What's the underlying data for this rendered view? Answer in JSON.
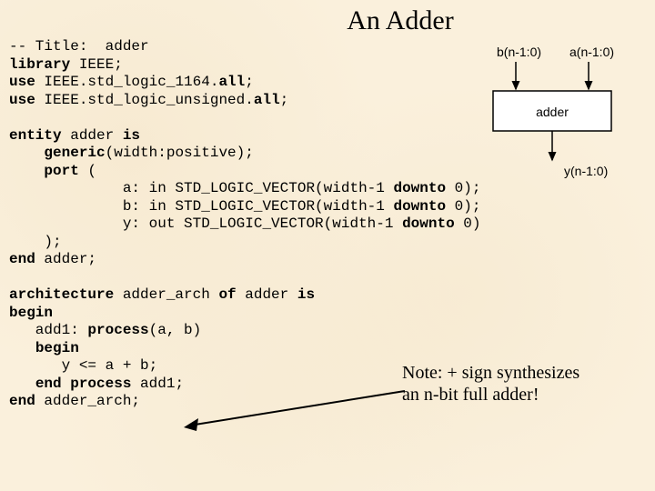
{
  "title": "An Adder",
  "code": {
    "l1a": "-- Title:  adder",
    "l2a": "library",
    "l2b": " IEEE;",
    "l3a": "use",
    "l3b": " IEEE.std_logic_1164.",
    "l3c": "all",
    "l3d": ";",
    "l4a": "use",
    "l4b": " IEEE.std_logic_unsigned.",
    "l4c": "all",
    "l4d": ";",
    "l6a": "entity",
    "l6b": " adder ",
    "l6c": "is",
    "l7a": "    ",
    "l7b": "generic",
    "l7c": "(width:positive);",
    "l8a": "    ",
    "l8b": "port",
    "l8c": " (",
    "l9a": "             a: in STD_LOGIC_VECTOR(width-1 ",
    "l9b": "downto",
    "l9c": " 0);",
    "l10a": "             b: in STD_LOGIC_VECTOR(width-1 ",
    "l10b": "downto",
    "l10c": " 0);",
    "l11a": "             y: out STD_LOGIC_VECTOR(width-1 ",
    "l11b": "downto",
    "l11c": " 0)",
    "l12a": "    );",
    "l13a": "end",
    "l13b": " adder;",
    "l15a": "architecture",
    "l15b": " adder_arch ",
    "l15c": "of",
    "l15d": " adder ",
    "l15e": "is",
    "l16a": "begin",
    "l17a": "   add1: ",
    "l17b": "process",
    "l17c": "(a, b)",
    "l18a": "   ",
    "l18b": "begin",
    "l19a": "      y <= a + b;",
    "l20a": "   ",
    "l20b": "end process",
    "l20c": " add1;",
    "l21a": "end",
    "l21b": " adder_arch;"
  },
  "diagram": {
    "port_b": "b(n-1:0)",
    "port_a": "a(n-1:0)",
    "block": "adder",
    "port_y": "y(n-1:0)"
  },
  "note": {
    "line1": "Note: + sign synthesizes",
    "line2": "an n-bit full adder!"
  }
}
